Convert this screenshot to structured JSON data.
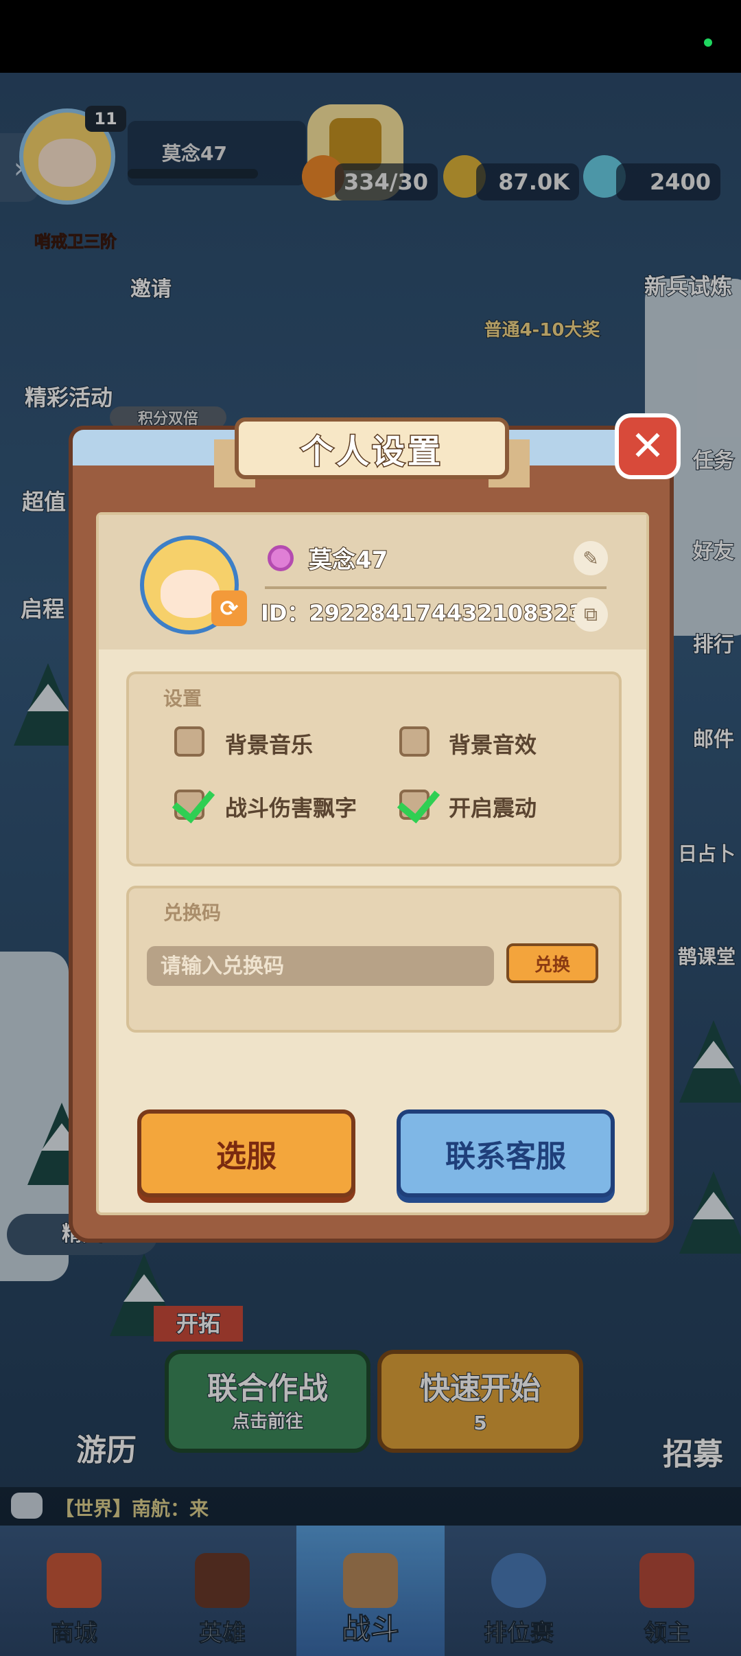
{
  "hud": {
    "player_name": "莫念47",
    "level": "11",
    "rank": "哨戒卫三阶",
    "resources": {
      "stamina": "334/30",
      "gold": "87.0K",
      "gems": "2400"
    }
  },
  "scene_labels": {
    "invite": "邀请",
    "events": "精彩活动",
    "points_double": "积分双倍",
    "value": "超值",
    "journey": "启程",
    "newbie_trial": "新兵试炼",
    "grand_prize": "普通4-10大奖",
    "task": "任务",
    "friends": "好友",
    "ranking": "排行",
    "mail": "邮件",
    "divination": "日占卜",
    "classroom": "鹊课堂",
    "elite": "精英",
    "pioneer": "开拓",
    "coop_battle": "联合作战",
    "coop_sub": "点击前往",
    "quick_start": "快速开始",
    "quick_cost": "5",
    "travel": "游历",
    "recruit": "招募"
  },
  "chat": {
    "text": "【世界】南航：来"
  },
  "nav": [
    {
      "label": "商城"
    },
    {
      "label": "英雄"
    },
    {
      "label": "战斗"
    },
    {
      "label": "排位赛"
    },
    {
      "label": "领主"
    }
  ],
  "modal": {
    "title": "个人设置",
    "profile": {
      "name": "莫念47",
      "id": "ID：292284174432108323"
    },
    "settings": {
      "title": "设置",
      "options": [
        {
          "label": "背景音乐",
          "checked": false
        },
        {
          "label": "背景音效",
          "checked": false
        },
        {
          "label": "战斗伤害飘字",
          "checked": true
        },
        {
          "label": "开启震动",
          "checked": true
        }
      ]
    },
    "redeem": {
      "title": "兑换码",
      "placeholder": "请输入兑换码",
      "button": "兑换"
    },
    "buttons": {
      "server": "选服",
      "support": "联系客服"
    }
  }
}
